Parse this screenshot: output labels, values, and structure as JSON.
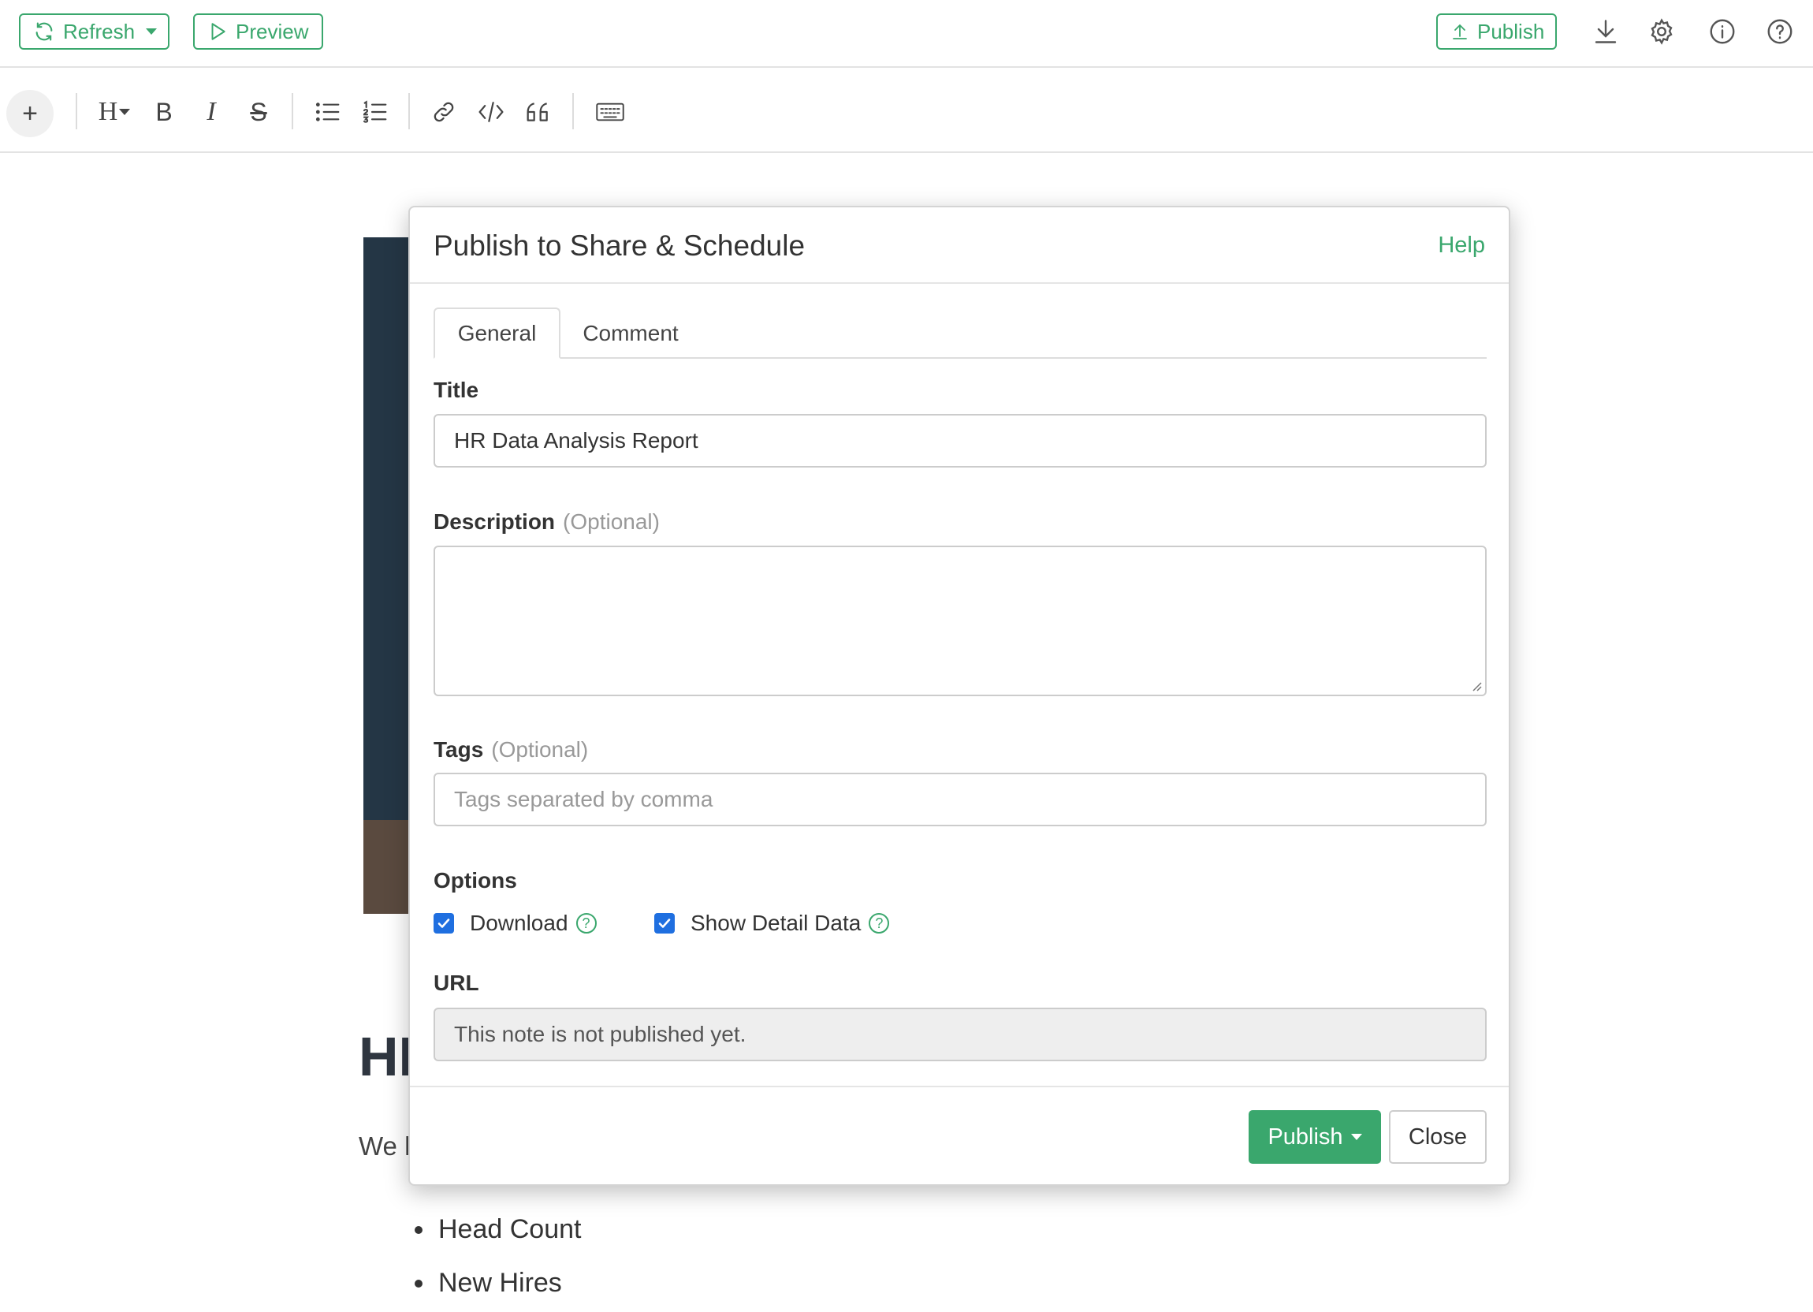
{
  "topbar": {
    "refresh_label": "Refresh",
    "preview_label": "Preview",
    "publish_label": "Publish",
    "accent_color": "#3aa76d",
    "icons": [
      "refresh-icon",
      "play-icon",
      "upload-icon",
      "download-icon",
      "gear-icon",
      "info-icon",
      "help-icon"
    ]
  },
  "toolbar": {
    "add_label": "+",
    "heading_label": "H",
    "bold_label": "B",
    "italic_label": "I",
    "strike_label": "S",
    "icons": [
      "bullet-list-icon",
      "numbered-list-icon",
      "link-icon",
      "code-icon",
      "quote-icon",
      "keyboard-icon"
    ]
  },
  "document": {
    "heading_partial": "HI",
    "paragraph_partial": "We h",
    "bullets": [
      "Head Count",
      "New Hires"
    ]
  },
  "modal": {
    "title": "Publish to Share & Schedule",
    "help_label": "Help",
    "tabs": [
      {
        "label": "General",
        "active": true
      },
      {
        "label": "Comment",
        "active": false
      }
    ],
    "fields": {
      "title_label": "Title",
      "title_value": "HR Data Analysis Report",
      "description_label": "Description",
      "description_optional": "(Optional)",
      "description_value": "",
      "tags_label": "Tags",
      "tags_optional": "(Optional)",
      "tags_placeholder": "Tags separated by comma",
      "options_label": "Options",
      "option_download": "Download",
      "option_download_checked": true,
      "option_detail": "Show Detail Data",
      "option_detail_checked": true,
      "url_label": "URL",
      "url_value": "This note is not published yet."
    },
    "footer": {
      "publish_label": "Publish",
      "close_label": "Close"
    }
  }
}
